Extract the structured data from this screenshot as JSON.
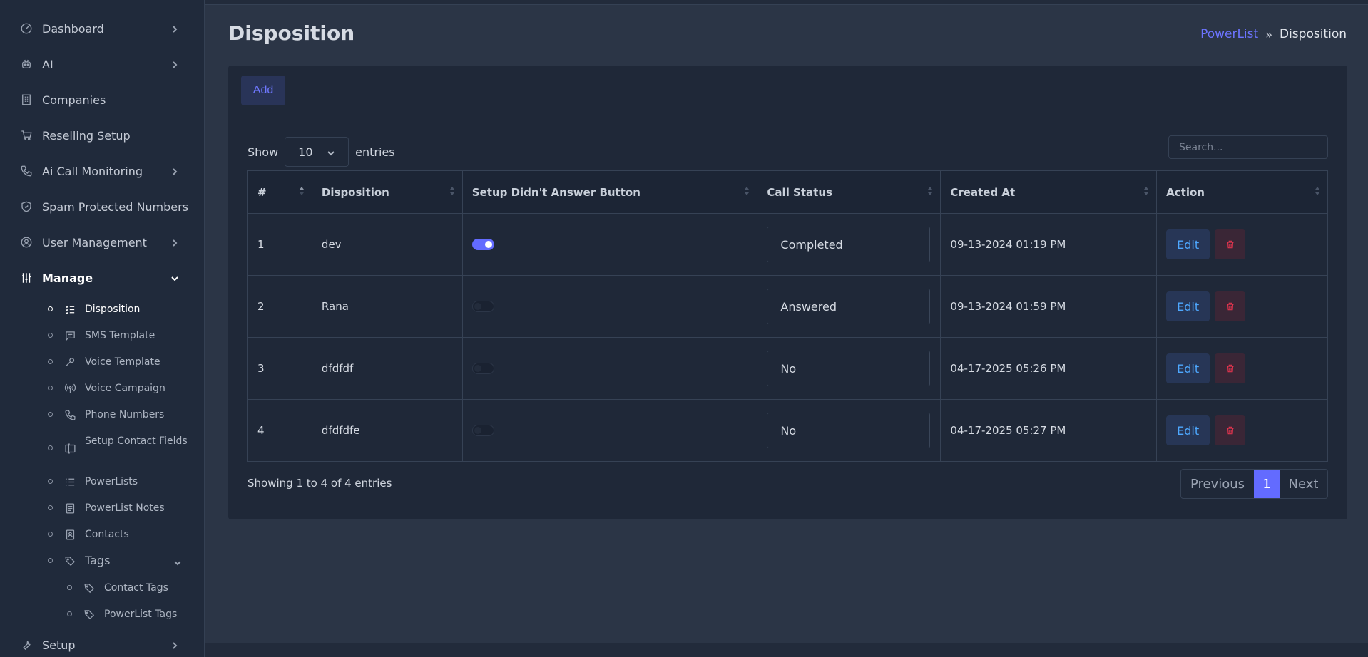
{
  "sidebar": {
    "items": [
      {
        "label": "Dashboard"
      },
      {
        "label": "AI"
      },
      {
        "label": "Companies"
      },
      {
        "label": "Reselling Setup"
      },
      {
        "label": "Ai Call Monitoring"
      },
      {
        "label": "Spam Protected Numbers"
      },
      {
        "label": "User Management"
      },
      {
        "label": "Manage"
      },
      {
        "label": "Setup"
      }
    ],
    "manage_items": [
      {
        "label": "Disposition"
      },
      {
        "label": "SMS Template"
      },
      {
        "label": "Voice Template"
      },
      {
        "label": "Voice Campaign"
      },
      {
        "label": "Phone Numbers"
      },
      {
        "label": "Setup Contact Fields"
      },
      {
        "label": "PowerLists"
      },
      {
        "label": "PowerList Notes"
      },
      {
        "label": "Contacts"
      },
      {
        "label": "Tags"
      }
    ],
    "tag_items": [
      {
        "label": "Contact Tags"
      },
      {
        "label": "PowerList Tags"
      }
    ]
  },
  "page": {
    "title": "Disposition",
    "breadcrumb": {
      "parent": "PowerList",
      "sep": "»",
      "current": "Disposition"
    }
  },
  "card": {
    "add_label": "Add",
    "show_label": "Show",
    "entries_label": "entries",
    "page_size": "10",
    "search_placeholder": "Search...",
    "columns": [
      "#",
      "Disposition",
      "Setup Didn't Answer Button",
      "Call Status",
      "Created At",
      "Action"
    ],
    "rows": [
      {
        "num": "1",
        "name": "dev",
        "toggle_on": true,
        "status": "Completed",
        "created": "09-13-2024 01:19 PM",
        "edit": "Edit"
      },
      {
        "num": "2",
        "name": "Rana",
        "toggle_on": false,
        "status": "Answered",
        "created": "09-13-2024 01:59 PM",
        "edit": "Edit"
      },
      {
        "num": "3",
        "name": "dfdfdf",
        "toggle_on": false,
        "status": "No",
        "created": "04-17-2025 05:26 PM",
        "edit": "Edit"
      },
      {
        "num": "4",
        "name": "dfdfdfe",
        "toggle_on": false,
        "status": "No",
        "created": "04-17-2025 05:27 PM",
        "edit": "Edit"
      }
    ],
    "info": "Showing 1 to 4 of 4 entries",
    "pager": {
      "prev": "Previous",
      "page": "1",
      "next": "Next"
    }
  },
  "colors": {
    "accent": "#636bff",
    "danger": "#e0344e",
    "edit": "#4ea8ff"
  }
}
